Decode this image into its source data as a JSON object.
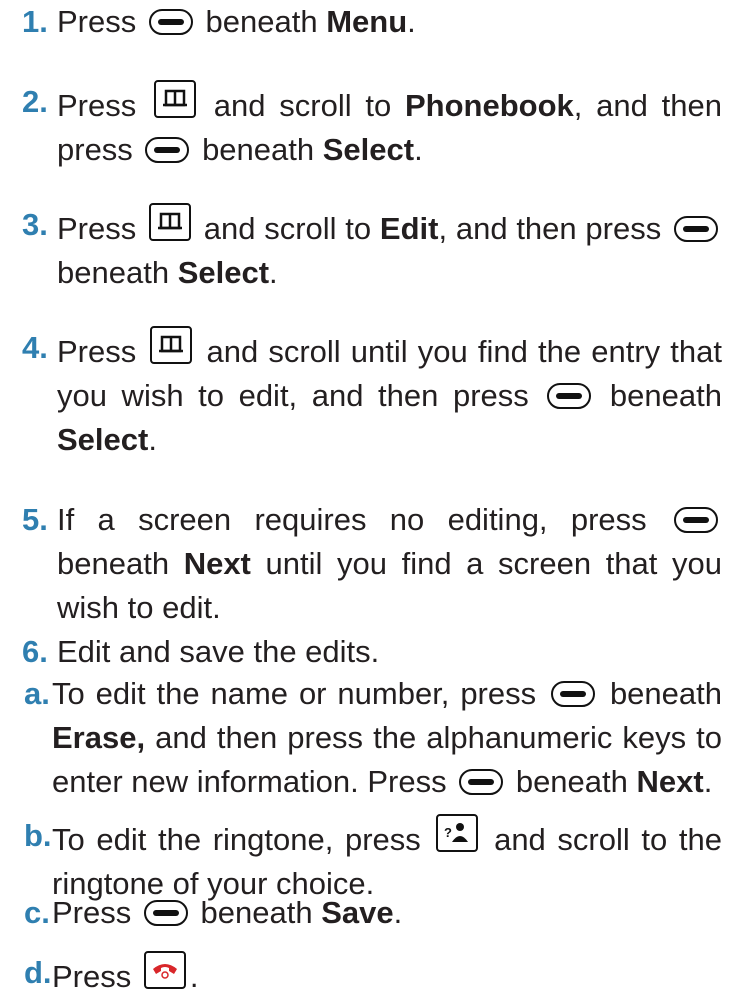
{
  "steps": [
    {
      "num": "1.",
      "parts": [
        "Press",
        "beneath",
        "Menu",
        "."
      ]
    },
    {
      "num": "2.",
      "parts": [
        "Press",
        "and scroll to",
        "Phonebook",
        ", and then press",
        "beneath",
        "Select",
        "."
      ]
    },
    {
      "num": "3.",
      "parts": [
        "Press",
        "and scroll to",
        "Edit",
        ", and then press",
        "beneath",
        "Select",
        "."
      ]
    },
    {
      "num": "4.",
      "parts": [
        "Press",
        "and scroll until you find the entry that you wish to edit, and then press",
        "beneath",
        "Select",
        "."
      ]
    },
    {
      "num": "5.",
      "parts": [
        "If a screen requires no editing, press",
        "beneath",
        "Next",
        "until you find a screen that you wish to edit."
      ]
    },
    {
      "num": "6.",
      "parts": [
        "Edit and save the edits."
      ]
    },
    {
      "num": "a.",
      "parts": [
        "To edit the name or number, press",
        "beneath",
        "Erase,",
        "and then press the alphanumeric keys to enter new information. Press",
        "beneath",
        "Next",
        "."
      ]
    },
    {
      "num": "b.",
      "parts": [
        "To edit the ringtone, press",
        "and scroll to the ringtone of your choice."
      ]
    },
    {
      "num": "c.",
      "parts": [
        "Press",
        "beneath",
        "Save",
        "."
      ]
    },
    {
      "num": "d.",
      "parts": [
        "Press",
        "."
      ]
    }
  ],
  "icons": {
    "softkey": "softkey-icon",
    "phonebook_key": "phonebook-key-icon",
    "ringtone_key": "ringtone-key-icon",
    "end_call_key": "end-call-key-icon"
  },
  "colors": {
    "step_number": "#2f7fb0",
    "text": "#231f20",
    "end_call_red": "#d9262a"
  }
}
